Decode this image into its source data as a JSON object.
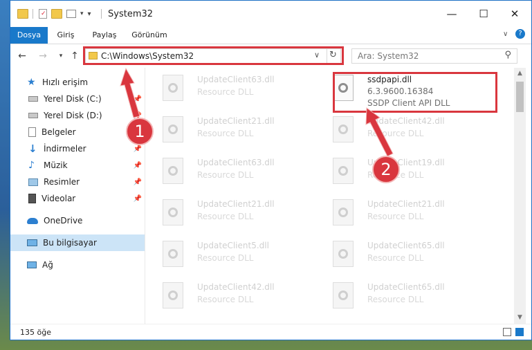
{
  "window": {
    "title": "System32",
    "controls": {
      "minimize": "—",
      "maximize": "☐",
      "close": "✕"
    }
  },
  "ribbon": {
    "tabs": [
      "Dosya",
      "Giriş",
      "Paylaş",
      "Görünüm"
    ],
    "active_tab": "Dosya"
  },
  "address": {
    "path": "C:\\Windows\\System32",
    "search_placeholder": "Ara: System32"
  },
  "nav_pane": {
    "items": [
      {
        "label": "Hızlı erişim",
        "icon": "star-icon",
        "pinned": false
      },
      {
        "label": "Yerel Disk (C:)",
        "icon": "drive-icon",
        "pinned": true
      },
      {
        "label": "Yerel Disk (D:)",
        "icon": "drive-icon",
        "pinned": true
      },
      {
        "label": "Belgeler",
        "icon": "documents-icon",
        "pinned": true
      },
      {
        "label": "İndirmeler",
        "icon": "download-icon",
        "pinned": true
      },
      {
        "label": "Müzik",
        "icon": "music-icon",
        "pinned": true
      },
      {
        "label": "Resimler",
        "icon": "pictures-icon",
        "pinned": true
      },
      {
        "label": "Videolar",
        "icon": "videos-icon",
        "pinned": true
      },
      {
        "label": "OneDrive",
        "icon": "cloud-icon",
        "pinned": false
      },
      {
        "label": "Bu bilgisayar",
        "icon": "computer-icon",
        "pinned": false,
        "selected": true
      },
      {
        "label": "Ağ",
        "icon": "network-icon",
        "pinned": false
      }
    ]
  },
  "files": {
    "left_column": [
      {
        "name": "UpdateClient63.dll",
        "desc": "Resource DLL"
      },
      {
        "name": "UpdateClient21.dll",
        "desc": "Resource DLL"
      },
      {
        "name": "UpdateClient63.dll",
        "desc": "Resource DLL"
      },
      {
        "name": "UpdateClient21.dll",
        "desc": "Resource DLL"
      },
      {
        "name": "UpdateClient5.dll",
        "desc": "Resource DLL"
      },
      {
        "name": "UpdateClient42.dll",
        "desc": "Resource DLL"
      }
    ],
    "right_column": [
      {
        "name": "ssdpapi.dll",
        "version": "6.3.9600.16384",
        "desc": "SSDP Client API DLL",
        "highlighted": true
      },
      {
        "name": "UpdateClient42.dll",
        "desc": "Resource DLL"
      },
      {
        "name": "UpdateClient19.dll",
        "desc": "Resource DLL"
      },
      {
        "name": "UpdateClient21.dll",
        "desc": "Resource DLL"
      },
      {
        "name": "UpdateClient65.dll",
        "desc": "Resource DLL"
      },
      {
        "name": "UpdateClient65.dll",
        "desc": "Resource DLL"
      }
    ]
  },
  "status": {
    "item_count": "135 öğe"
  },
  "annotations": {
    "badge1": "1",
    "badge2": "2",
    "color": "#d9363e"
  }
}
